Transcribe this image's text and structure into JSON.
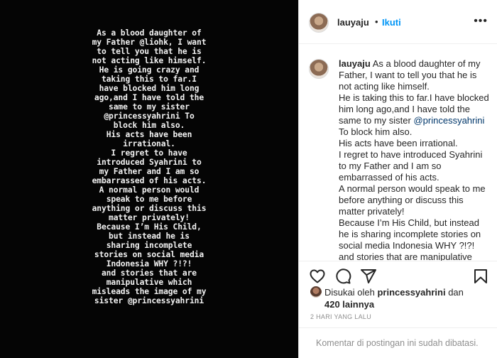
{
  "story": {
    "lines": [
      "As a blood daughter of",
      "my Father @liohk, I want",
      "to tell you that he is",
      "not acting like himself.",
      "He is going crazy and",
      "taking this to far.I",
      "have blocked him long",
      "ago,and I have told the",
      "same to my sister",
      "@princessyahrini To",
      "block him also.",
      "His acts have been",
      "irrational.",
      "I regret to have",
      "introduced Syahrini to",
      "my Father and I am so",
      "embarrassed of his acts.",
      "A normal person would",
      "speak to me before",
      "anything or discuss this",
      "matter privately!",
      "Because I’m His Child,",
      "but instead he is",
      "sharing incomplete",
      "stories on social media",
      "Indonesia WHY ?!?!",
      "and stories that are",
      "manipulative which",
      "misleads the image of my",
      "sister @princessyahrini"
    ]
  },
  "header": {
    "username": "lauyaju",
    "separator": "•",
    "follow_label": "Ikuti",
    "more_icon": "more-horizontal-icon"
  },
  "caption": {
    "username": "lauyaju",
    "p1": "As a blood daughter of my Father, I want to tell you that he is not acting like himself.",
    "p2a": "He is taking this to far.I have blocked him long ago,and I have told the same to my sister ",
    "mention": "@princessyahrini",
    "p2b": " To block him also.",
    "p3": "His acts have been irrational.",
    "p4": "I regret to have introduced Syahrini to my Father and I am so embarrassed of his acts.",
    "p5": "A normal person would speak to me before anything or discuss this matter privately!",
    "p6": "Because I’m His Child, but instead he is sharing incomplete stories on social media Indonesia WHY ?!?!",
    "p7": "and stories that are manipulative which misleads the image of my sister"
  },
  "actions": {
    "like_icon": "heart-icon",
    "comment_icon": "comment-icon",
    "share_icon": "share-icon",
    "save_icon": "bookmark-icon"
  },
  "likes": {
    "prefix": "Disukai oleh",
    "user": "princessyahrini",
    "connector": "dan",
    "count": "420 lainnya"
  },
  "timestamp": "2 HARI YANG LALU",
  "comments_disabled": "Komentar di postingan ini sudah dibatasi."
}
